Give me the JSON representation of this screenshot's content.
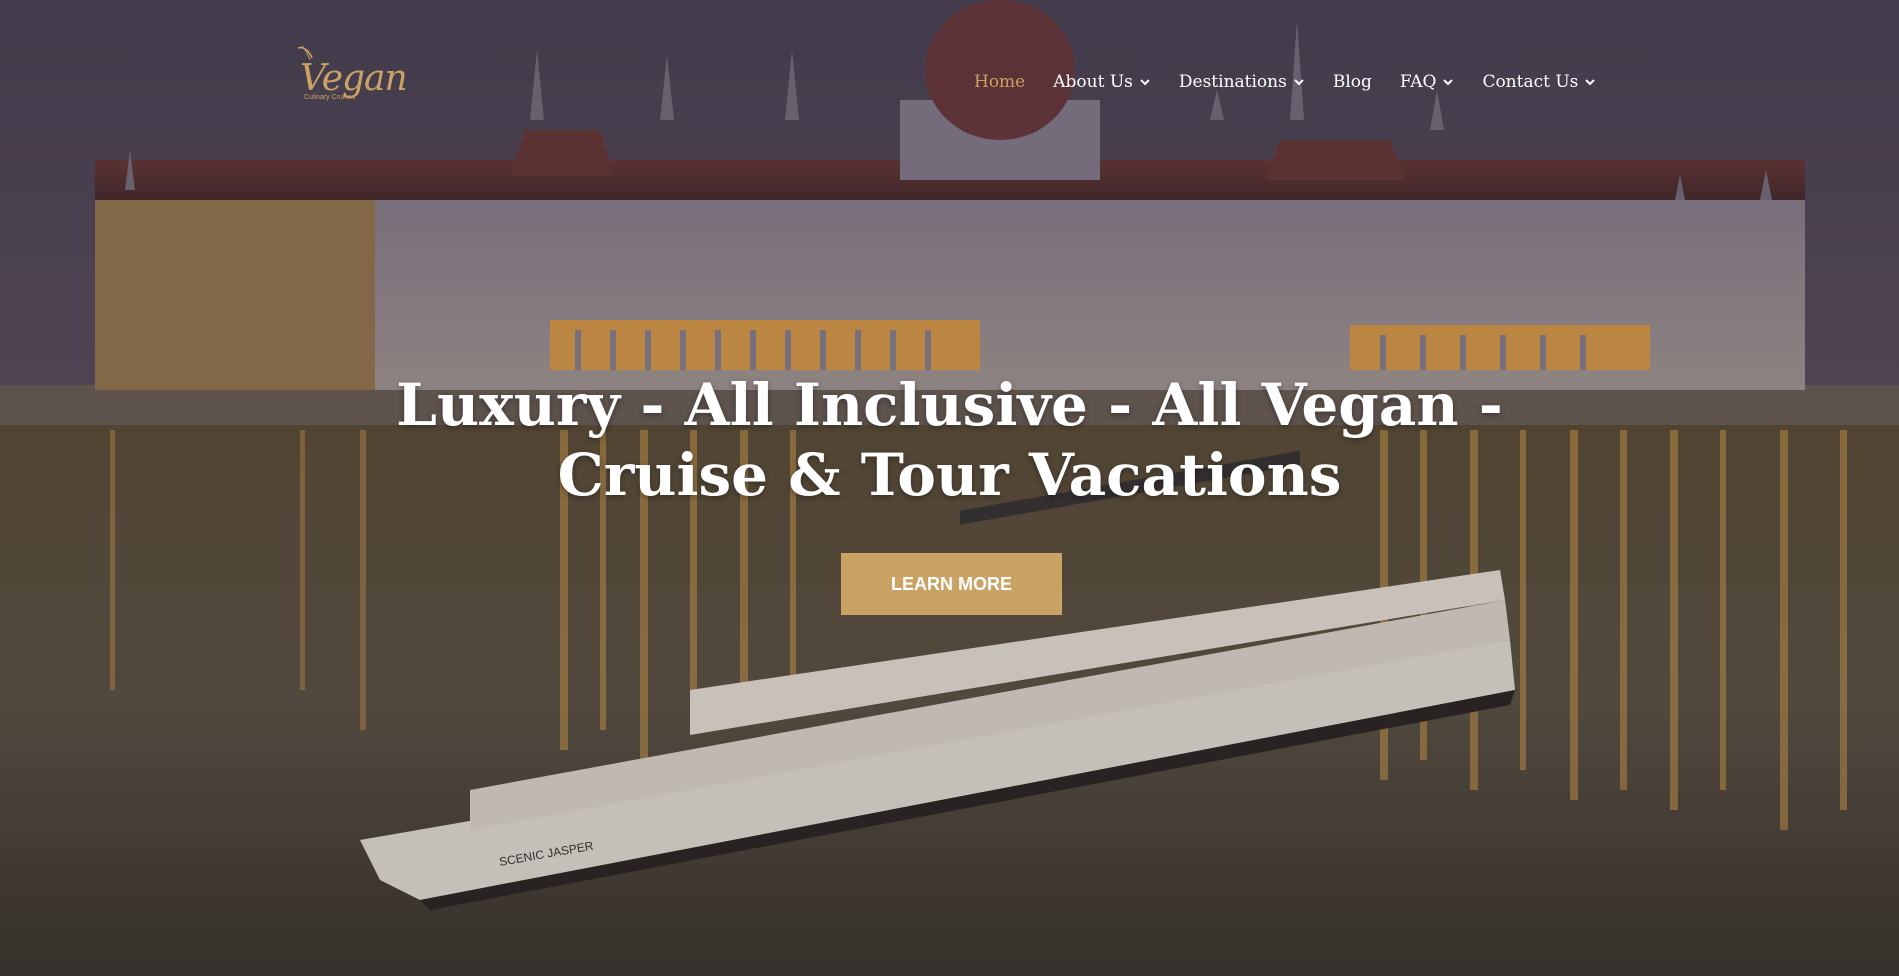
{
  "logo": {
    "word": "Vegan",
    "tagline": "Culinary Cruises"
  },
  "nav": {
    "items": [
      {
        "label": "Home",
        "has_dropdown": false,
        "active": true
      },
      {
        "label": "About Us",
        "has_dropdown": true,
        "active": false
      },
      {
        "label": "Destinations",
        "has_dropdown": true,
        "active": false
      },
      {
        "label": "Blog",
        "has_dropdown": false,
        "active": false
      },
      {
        "label": "FAQ",
        "has_dropdown": true,
        "active": false
      },
      {
        "label": "Contact Us",
        "has_dropdown": true,
        "active": false
      }
    ]
  },
  "hero": {
    "headline_line1": "Luxury - All Inclusive - All Vegan -",
    "headline_line2": "Cruise & Tour Vacations",
    "cta_label": "LEARN MORE",
    "ship_name": "SCENIC JASPER"
  },
  "colors": {
    "accent": "#c9a264",
    "nav_text": "#ffffff",
    "active_nav": "#c9a264"
  }
}
